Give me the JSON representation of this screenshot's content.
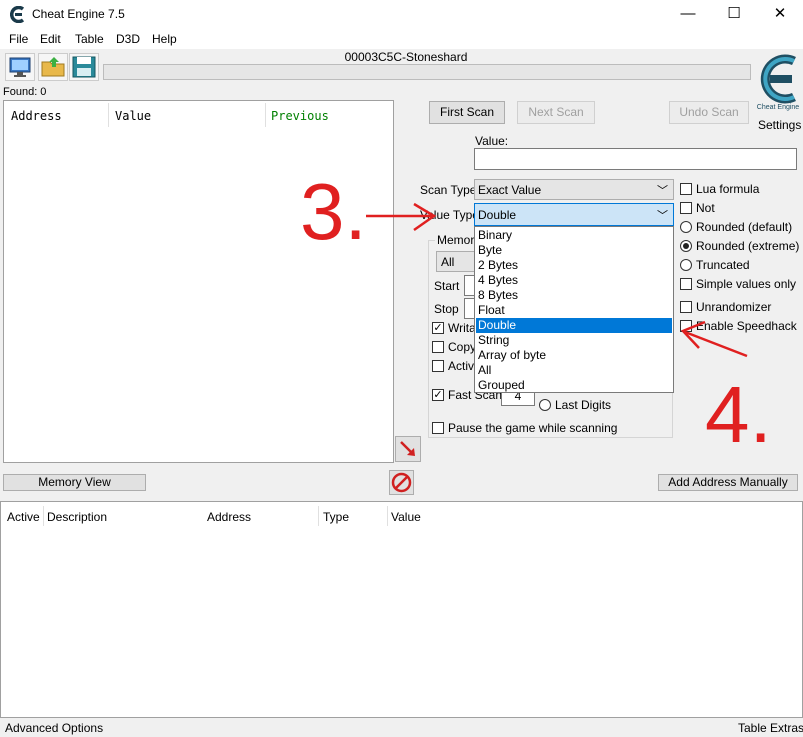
{
  "window": {
    "title": "Cheat Engine 7.5",
    "minimize": "—",
    "maximize": "☐",
    "close": "✕"
  },
  "menu": [
    "File",
    "Edit",
    "Table",
    "D3D",
    "Help"
  ],
  "process_name": "00003C5C-Stoneshard",
  "found_label": "Found: 0",
  "settings_label": "Settings",
  "results_columns": {
    "address": "Address",
    "value": "Value",
    "previous": "Previous"
  },
  "scan_buttons": {
    "first": "First Scan",
    "next": "Next Scan",
    "undo": "Undo Scan"
  },
  "value_label": "Value:",
  "scan_type": {
    "label": "Scan Type",
    "value": "Exact Value"
  },
  "value_type": {
    "label": "Value Type",
    "value": "Double"
  },
  "dropdown_options": [
    "Binary",
    "Byte",
    "2 Bytes",
    "4 Bytes",
    "8 Bytes",
    "Float",
    "Double",
    "String",
    "Array of byte",
    "All",
    "Grouped"
  ],
  "dropdown_selected_index": 6,
  "memory_group": {
    "label_partial": "Memor",
    "region_value": "All",
    "start_label": "Start",
    "stop_label": "Stop"
  },
  "mem_checks": [
    {
      "label": "Writa",
      "checked": true
    },
    {
      "label": "Copy",
      "checked": false
    },
    {
      "label": "Activ",
      "checked": false
    }
  ],
  "fast_scan": {
    "label": "Fast Scan",
    "value": "4",
    "checked": true
  },
  "last_digits_label": "Last Digits",
  "pause_label": "Pause the game while scanning",
  "right_options": [
    {
      "type": "check",
      "label": "Lua formula",
      "checked": false
    },
    {
      "type": "check",
      "label": "Not",
      "checked": false
    },
    {
      "type": "radio",
      "label": "Rounded (default)",
      "checked": false
    },
    {
      "type": "radio",
      "label": "Rounded (extreme)",
      "checked": true
    },
    {
      "type": "radio",
      "label": "Truncated",
      "checked": false
    },
    {
      "type": "check",
      "label": "Simple values only",
      "checked": false
    },
    {
      "type": "check",
      "label": "Unrandomizer",
      "checked": false
    },
    {
      "type": "check",
      "label": "Enable Speedhack",
      "checked": false
    }
  ],
  "memory_view_button": "Memory View",
  "add_address_button": "Add Address Manually",
  "address_list_columns": {
    "active": "Active",
    "description": "Description",
    "address": "Address",
    "type": "Type",
    "value": "Value"
  },
  "status_left": "Advanced Options",
  "status_right": "Table Extras",
  "annotations": {
    "step3": "3.",
    "step4": "4."
  },
  "colors": {
    "annotation_red": "#e02020",
    "selection_blue": "#0078d7",
    "previous_green": "#008000"
  }
}
